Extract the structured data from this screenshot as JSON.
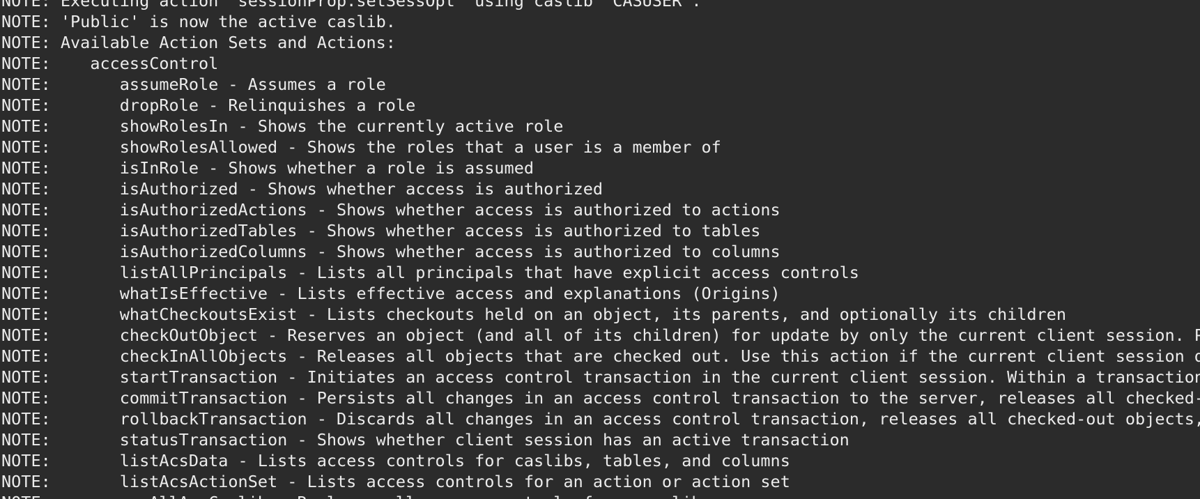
{
  "log": {
    "lines": [
      "NOTE: Executing action 'sessionProp.setSessOpt' using caslib 'CASUSER'.",
      "NOTE: 'Public' is now the active caslib.",
      "NOTE: Available Action Sets and Actions:",
      "NOTE:    accessControl",
      "NOTE:       assumeRole - Assumes a role",
      "NOTE:       dropRole - Relinquishes a role",
      "NOTE:       showRolesIn - Shows the currently active role",
      "NOTE:       showRolesAllowed - Shows the roles that a user is a member of",
      "NOTE:       isInRole - Shows whether a role is assumed",
      "NOTE:       isAuthorized - Shows whether access is authorized",
      "NOTE:       isAuthorizedActions - Shows whether access is authorized to actions",
      "NOTE:       isAuthorizedTables - Shows whether access is authorized to tables",
      "NOTE:       isAuthorizedColumns - Shows whether access is authorized to columns",
      "NOTE:       listAllPrincipals - Lists all principals that have explicit access controls",
      "NOTE:       whatIsEffective - Lists effective access and explanations (Origins)",
      "NOTE:       whatCheckoutsExist - Lists checkouts held on an object, its parents, and optionally its children",
      "NOTE:       checkOutObject - Reserves an object (and all of its children) for update by only the current client session. Pr",
      "NOTE:       checkInAllObjects - Releases all objects that are checked out. Use this action if the current client session do",
      "NOTE:       startTransaction - Initiates an access control transaction in the current client session. Within a transaction,",
      "NOTE:       commitTransaction - Persists all changes in an access control transaction to the server, releases all checked-o",
      "NOTE:       rollbackTransaction - Discards all changes in an access control transaction, releases all checked-out objects,",
      "NOTE:       statusTransaction - Shows whether client session has an active transaction",
      "NOTE:       listAcsData - Lists access controls for caslibs, tables, and columns",
      "NOTE:       listAcsActionSet - Lists access controls for an action or action set",
      "NOTE:       repAllAcsCaslib - Replaces all access controls for a caslib"
    ]
  }
}
